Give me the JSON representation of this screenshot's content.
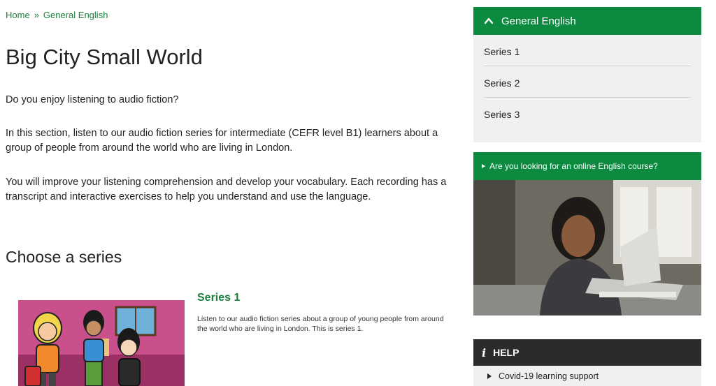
{
  "breadcrumb": {
    "home": "Home",
    "separator": "»",
    "current": "General English"
  },
  "page": {
    "title": "Big City Small World",
    "paragraphs": [
      "Do you enjoy listening to audio fiction?",
      "In this section, listen to our audio fiction series for intermediate (CEFR level B1) learners about a group of people from around the world who are living in London.",
      "You will improve your listening comprehension and develop your vocabulary. Each recording has a transcript and interactive exercises to help you understand and use the language."
    ],
    "section_heading": "Choose a series"
  },
  "series_cards": [
    {
      "title": "Series 1",
      "description": "Listen to our audio fiction series about a group of young people from around the world who are living in London. This is series 1.",
      "icon": "cartoon-characters-image"
    }
  ],
  "sidebar": {
    "nav": {
      "header": "General English",
      "icon": "chevron-up-icon",
      "items": [
        "Series 1",
        "Series 2",
        "Series 3"
      ]
    },
    "promo": {
      "label": "Are you looking for an online English course?",
      "icon": "triangle-right-icon"
    },
    "help": {
      "header": "HELP",
      "icon": "info-icon",
      "items": [
        "Covid-19 learning support"
      ]
    }
  },
  "colors": {
    "brand_green": "#0b8a40",
    "link_green": "#1a7f3c",
    "help_dark": "#2b2b2b",
    "panel_grey": "#f0f0f0"
  }
}
